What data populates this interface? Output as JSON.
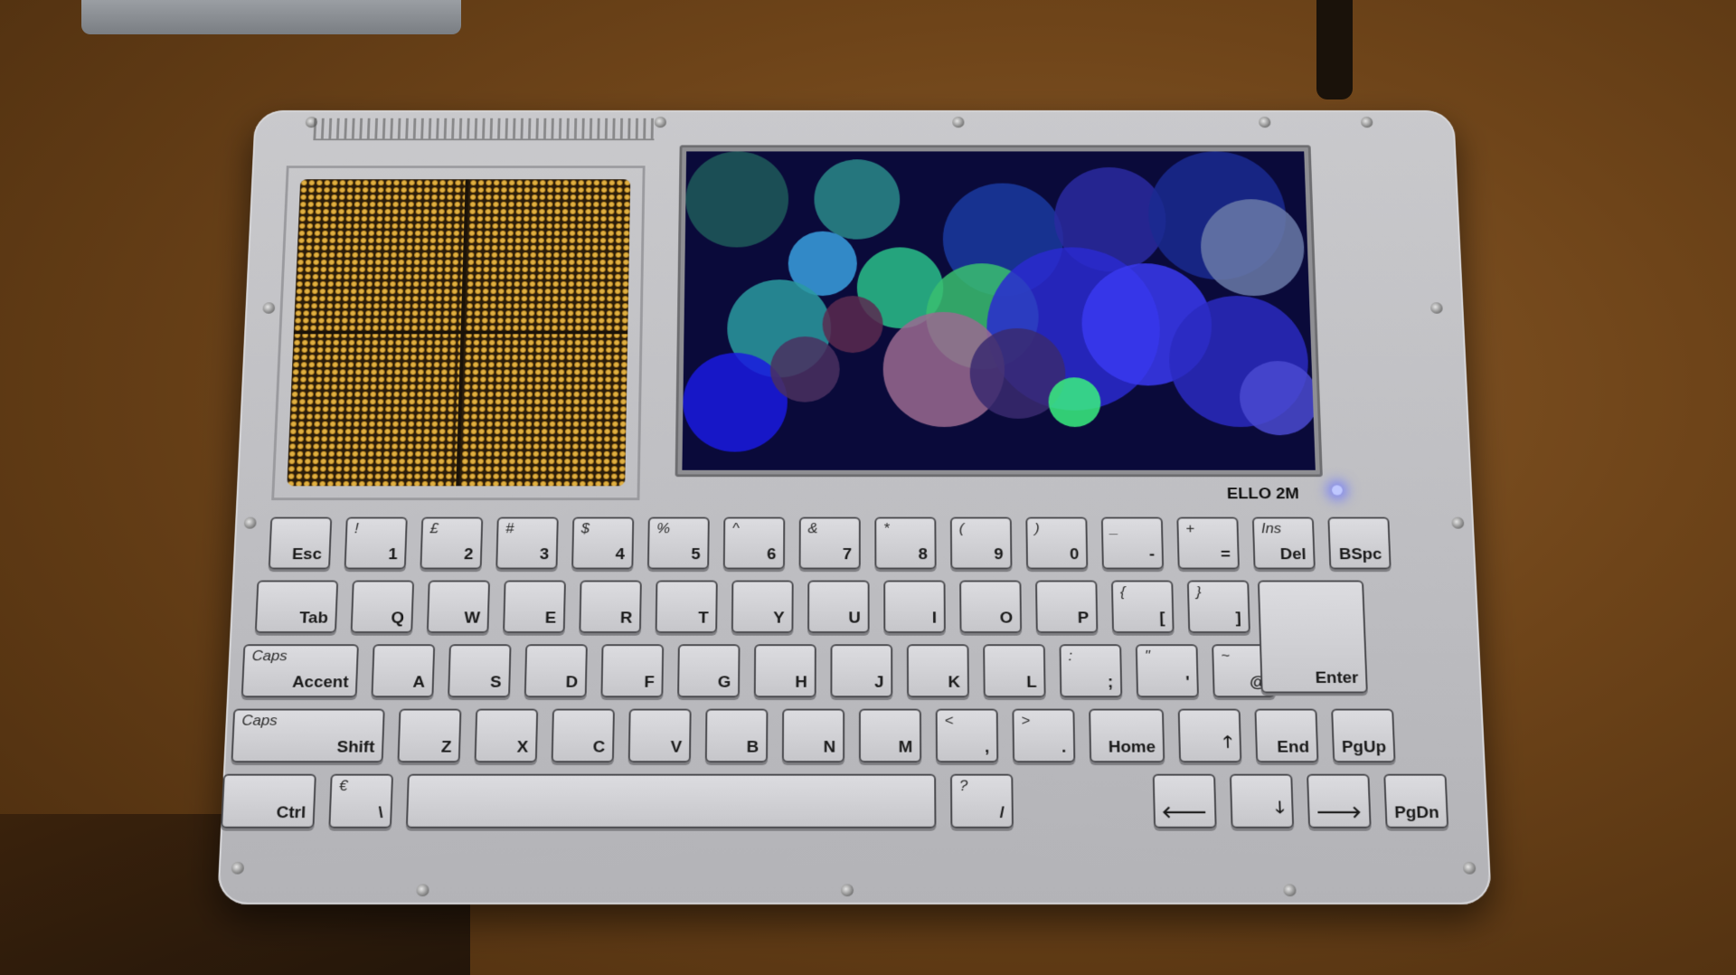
{
  "device": {
    "brand_label": "ELLO 2M"
  },
  "keyboard": {
    "rows": [
      [
        {
          "main": "Esc",
          "alt": ""
        },
        {
          "main": "1",
          "alt": "!"
        },
        {
          "main": "2",
          "alt": "£"
        },
        {
          "main": "3",
          "alt": "#"
        },
        {
          "main": "4",
          "alt": "$"
        },
        {
          "main": "5",
          "alt": "%"
        },
        {
          "main": "6",
          "alt": "^"
        },
        {
          "main": "7",
          "alt": "&"
        },
        {
          "main": "8",
          "alt": "*"
        },
        {
          "main": "9",
          "alt": "("
        },
        {
          "main": "0",
          "alt": ")"
        },
        {
          "main": "-",
          "alt": "_"
        },
        {
          "main": "=",
          "alt": "+"
        },
        {
          "main": "Del",
          "alt": "Ins"
        },
        {
          "main": "BSpc",
          "alt": ""
        }
      ],
      [
        {
          "main": "Tab",
          "alt": ""
        },
        {
          "main": "Q",
          "alt": ""
        },
        {
          "main": "W",
          "alt": ""
        },
        {
          "main": "E",
          "alt": ""
        },
        {
          "main": "R",
          "alt": ""
        },
        {
          "main": "T",
          "alt": ""
        },
        {
          "main": "Y",
          "alt": ""
        },
        {
          "main": "U",
          "alt": ""
        },
        {
          "main": "I",
          "alt": ""
        },
        {
          "main": "O",
          "alt": ""
        },
        {
          "main": "P",
          "alt": ""
        },
        {
          "main": "[",
          "alt": "{"
        },
        {
          "main": "]",
          "alt": "}"
        }
      ],
      [
        {
          "main": "Accent",
          "alt": "Caps"
        },
        {
          "main": "A",
          "alt": ""
        },
        {
          "main": "S",
          "alt": ""
        },
        {
          "main": "D",
          "alt": ""
        },
        {
          "main": "F",
          "alt": ""
        },
        {
          "main": "G",
          "alt": ""
        },
        {
          "main": "H",
          "alt": ""
        },
        {
          "main": "J",
          "alt": ""
        },
        {
          "main": "K",
          "alt": ""
        },
        {
          "main": "L",
          "alt": ""
        },
        {
          "main": ";",
          "alt": ":"
        },
        {
          "main": "'",
          "alt": "\""
        },
        {
          "main": "@",
          "alt": "~"
        }
      ],
      [
        {
          "main": "Shift",
          "alt": "Caps"
        },
        {
          "main": "Z",
          "alt": ""
        },
        {
          "main": "X",
          "alt": ""
        },
        {
          "main": "C",
          "alt": ""
        },
        {
          "main": "V",
          "alt": ""
        },
        {
          "main": "B",
          "alt": ""
        },
        {
          "main": "N",
          "alt": ""
        },
        {
          "main": "M",
          "alt": ""
        },
        {
          "main": ",",
          "alt": "<"
        },
        {
          "main": ".",
          "alt": ">"
        },
        {
          "main": "Home",
          "alt": ""
        },
        {
          "main": "🡑",
          "alt": ""
        },
        {
          "main": "End",
          "alt": ""
        },
        {
          "main": "PgUp",
          "alt": ""
        }
      ],
      [
        {
          "main": "Ctrl",
          "alt": ""
        },
        {
          "main": "\\",
          "alt": "€"
        },
        {
          "main": "",
          "alt": ""
        },
        {
          "main": "/",
          "alt": "?"
        },
        {
          "main": "🡐",
          "alt": ""
        },
        {
          "main": "🡓",
          "alt": ""
        },
        {
          "main": "🡒",
          "alt": ""
        },
        {
          "main": "PgDn",
          "alt": ""
        }
      ]
    ],
    "enter": {
      "main": "Enter",
      "alt": ""
    }
  },
  "colors": {
    "board": "#c4c4c8",
    "screen_bg": "#0a0a3a",
    "led": "#8890ff"
  }
}
